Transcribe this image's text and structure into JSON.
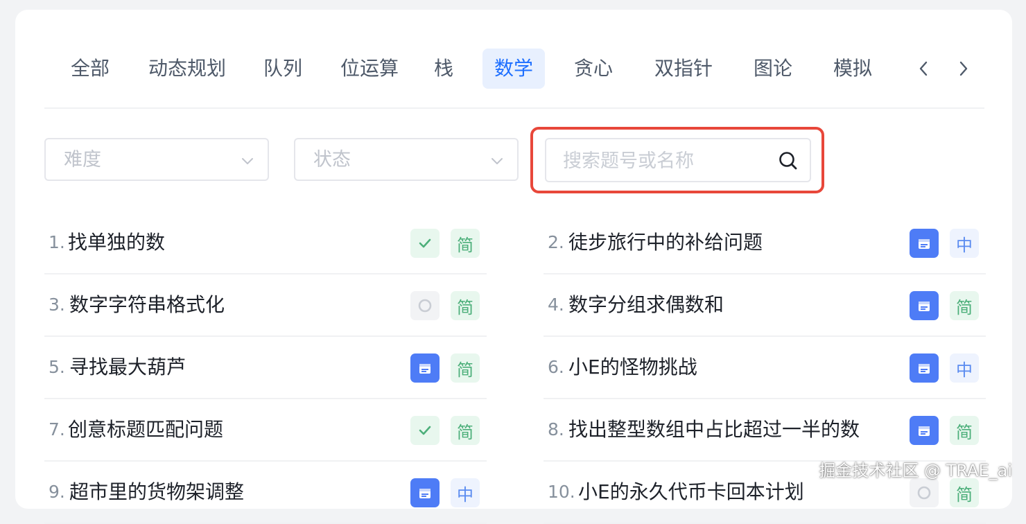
{
  "tabs": [
    {
      "label": "全部",
      "active": false
    },
    {
      "label": "动态规划",
      "active": false
    },
    {
      "label": "队列",
      "active": false
    },
    {
      "label": "位运算",
      "active": false
    },
    {
      "label": "栈",
      "active": false
    },
    {
      "label": "数学",
      "active": true
    },
    {
      "label": "贪心",
      "active": false
    },
    {
      "label": "双指针",
      "active": false
    },
    {
      "label": "图论",
      "active": false
    },
    {
      "label": "模拟",
      "active": false
    }
  ],
  "filters": {
    "difficulty_placeholder": "难度",
    "status_placeholder": "状态",
    "search_placeholder": "搜索题号或名称"
  },
  "problems": [
    {
      "num": "1.",
      "title": "找单独的数",
      "status": "done",
      "difficulty": "简"
    },
    {
      "num": "2.",
      "title": "徒步旅行中的补给问题",
      "status": "calendar",
      "difficulty": "中"
    },
    {
      "num": "3.",
      "title": "数字字符串格式化",
      "status": "todo",
      "difficulty": "简"
    },
    {
      "num": "4.",
      "title": "数字分组求偶数和",
      "status": "calendar",
      "difficulty": "简"
    },
    {
      "num": "5.",
      "title": "寻找最大葫芦",
      "status": "calendar",
      "difficulty": "简"
    },
    {
      "num": "6.",
      "title": "小E的怪物挑战",
      "status": "calendar",
      "difficulty": "中"
    },
    {
      "num": "7.",
      "title": "创意标题匹配问题",
      "status": "done",
      "difficulty": "简"
    },
    {
      "num": "8.",
      "title": "找出整型数组中占比超过一半的数",
      "status": "calendar",
      "difficulty": "简"
    },
    {
      "num": "9.",
      "title": "超市里的货物架调整",
      "status": "calendar",
      "difficulty": "中"
    },
    {
      "num": "10.",
      "title": "小E的永久代币卡回本计划",
      "status": "todo",
      "difficulty": "简"
    }
  ],
  "watermark": "掘金技术社区 @ TRAE_ai",
  "colors": {
    "accent": "#1e6fff",
    "highlight": "#e8473a",
    "easy": "#4caf7a",
    "medium": "#5a8bf0",
    "calendar": "#4e7cf6"
  }
}
